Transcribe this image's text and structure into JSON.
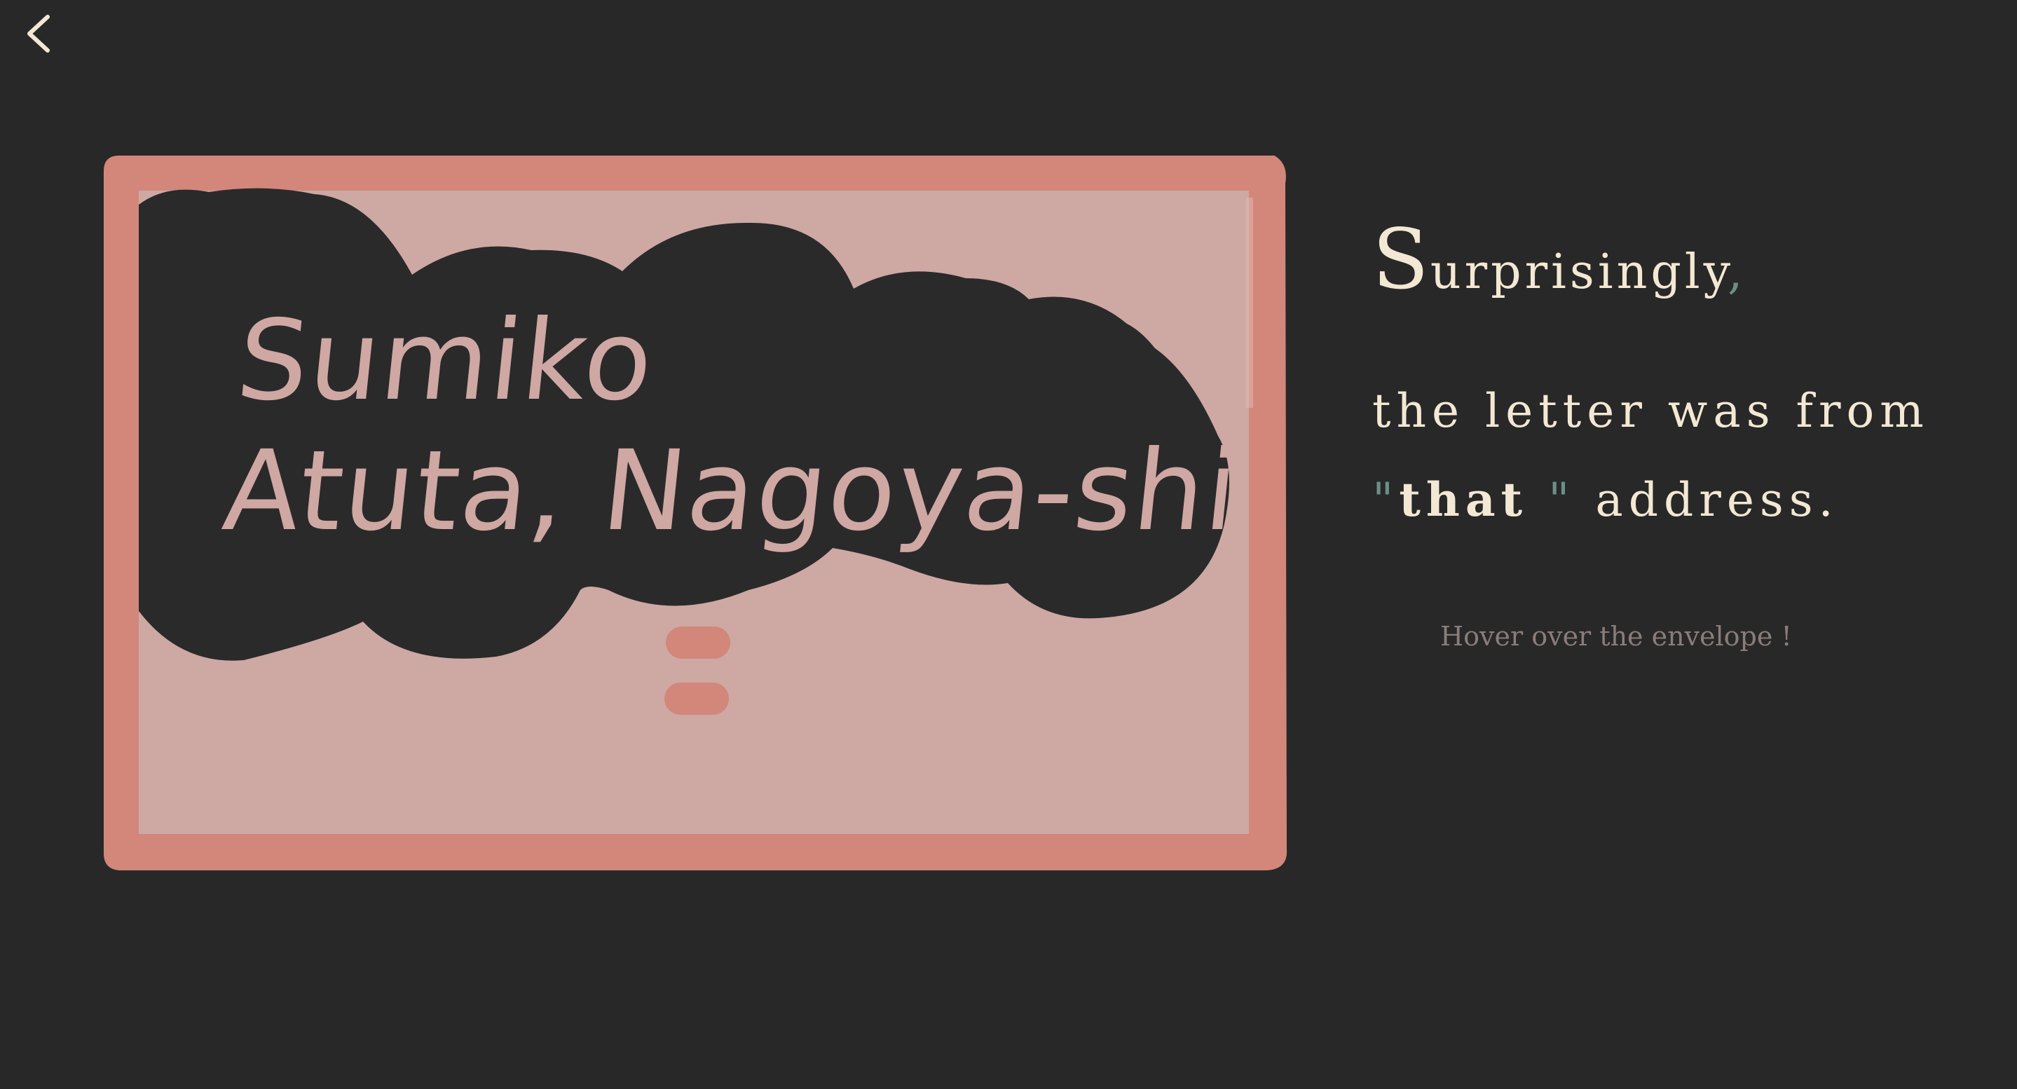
{
  "nav": {
    "back_icon": "chevron-left-icon"
  },
  "envelope": {
    "name_line": "Sumiko",
    "address_line": "Atuta, Nagoya-shi",
    "colors": {
      "border": "#d2877a",
      "paper": "#cea8a3",
      "ink_blot": "#2a2a2a",
      "text": "#cfa7a3"
    }
  },
  "headline": {
    "drop_cap": "S",
    "line1_rest": "urprisingly",
    "line1_punct": ",",
    "line2": "the letter was from",
    "line3_open_quote": "\"",
    "line3_bold": "that",
    "line3_close_quote": " \"",
    "line3_rest": " address.",
    "accent_color": "#6c8f87",
    "text_color": "#f3e8d3"
  },
  "hint": "Hover over the envelope !"
}
